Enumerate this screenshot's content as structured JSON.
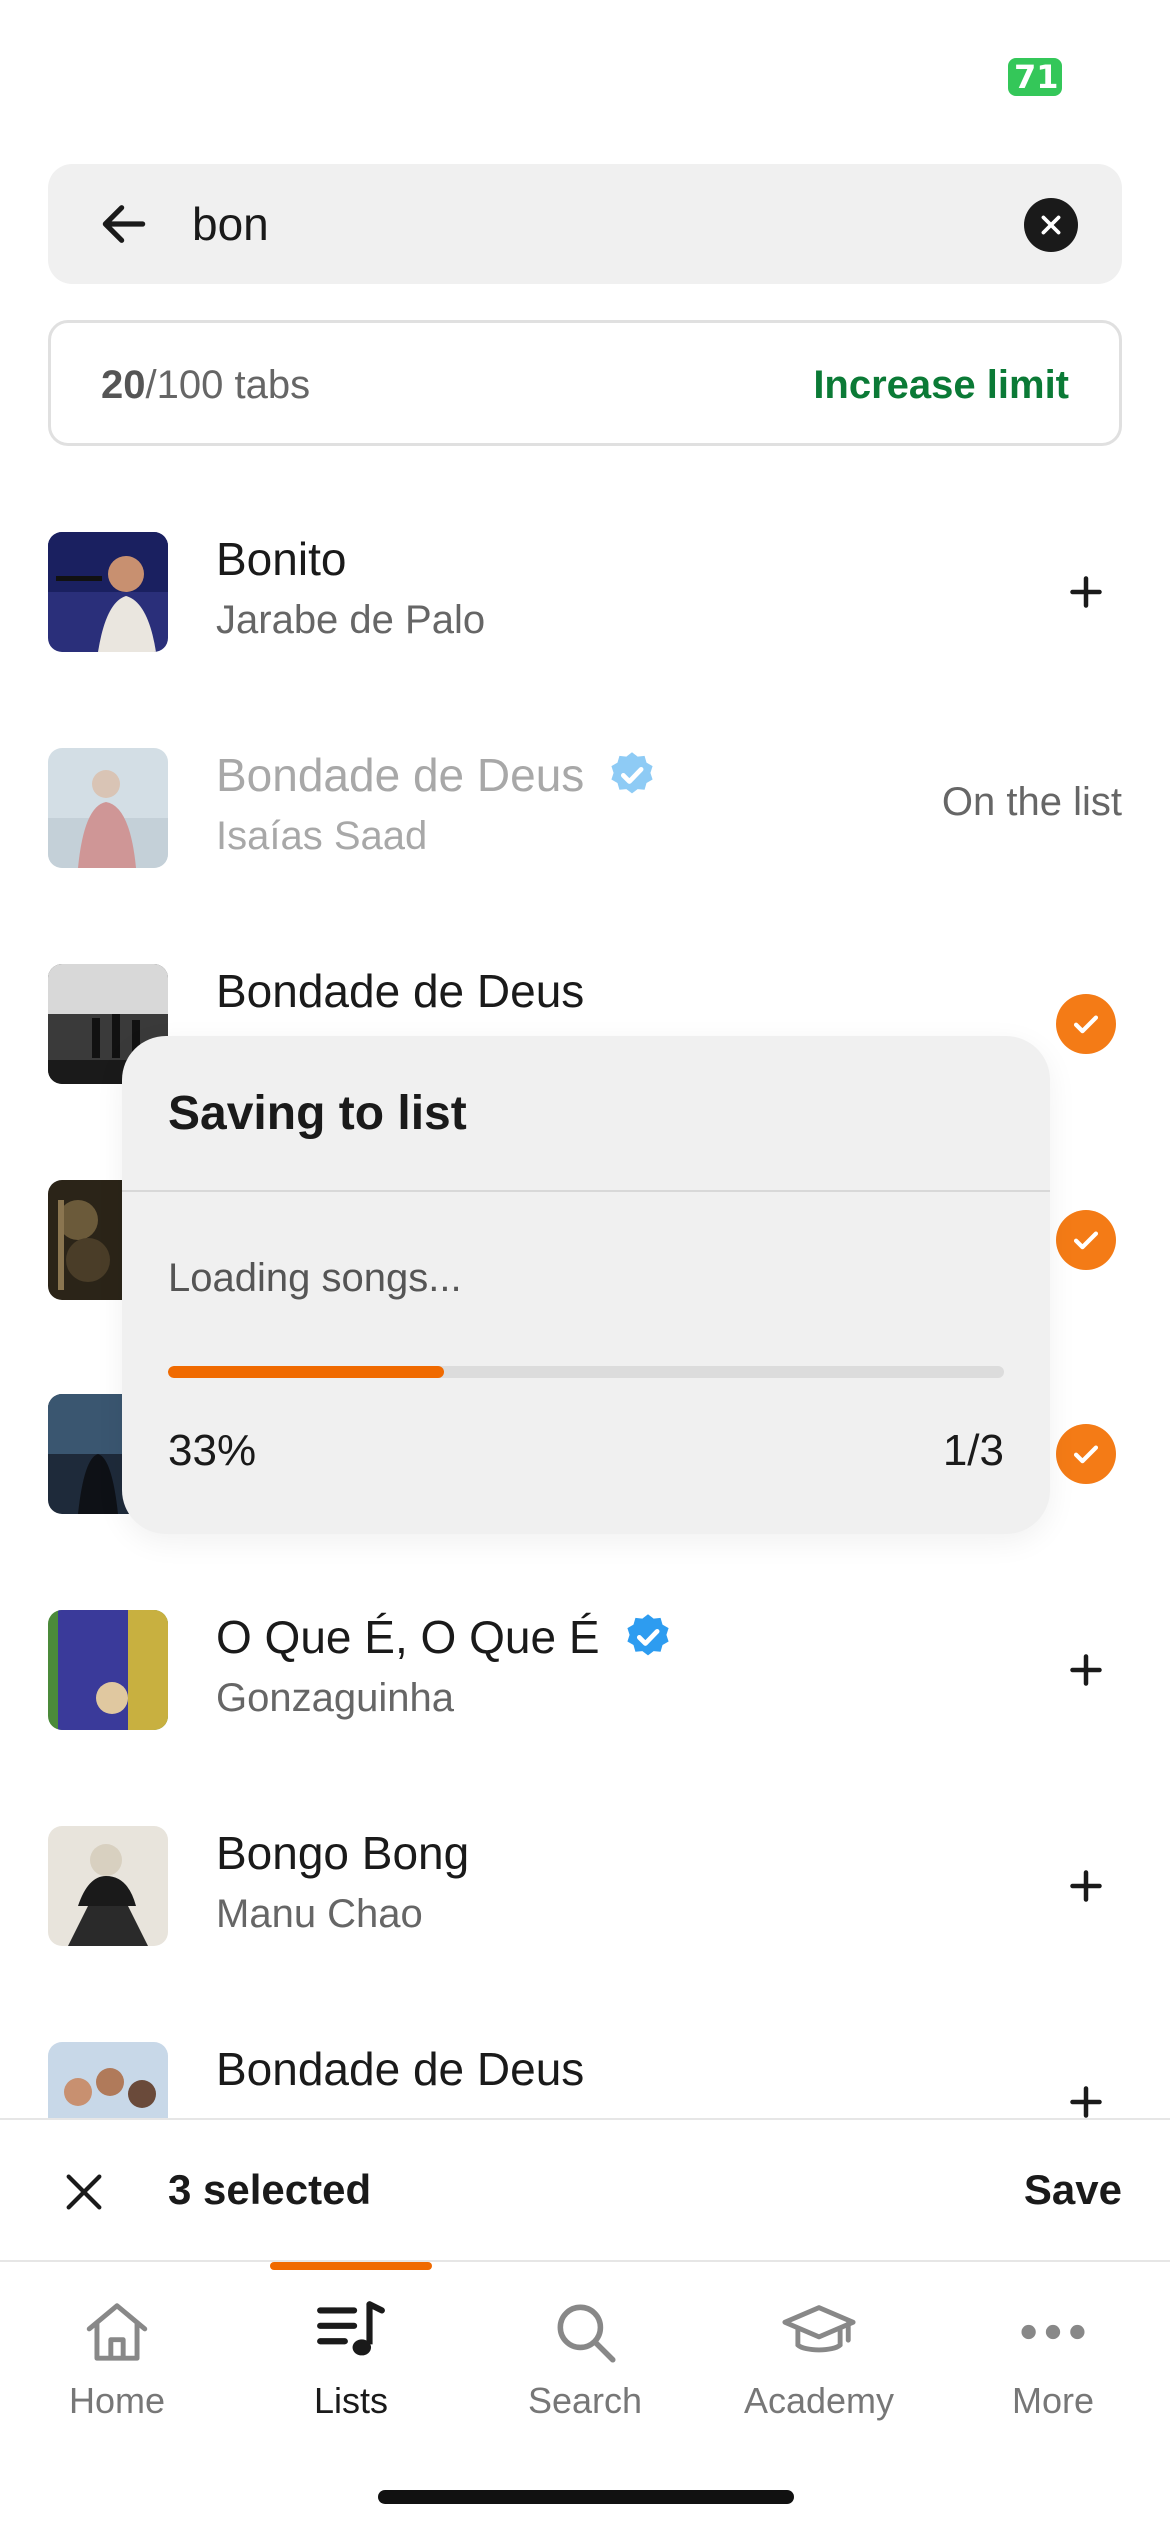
{
  "status_bar": {
    "battery": "71"
  },
  "search": {
    "value": "bon",
    "placeholder": ""
  },
  "limit": {
    "used": "20",
    "rest": "/100 tabs",
    "action": "Increase limit"
  },
  "songs": [
    {
      "title": "Bonito",
      "artist": "Jarabe de Palo",
      "verified": false,
      "state": "add"
    },
    {
      "title": "Bondade de Deus",
      "artist": "Isaías Saad",
      "verified": true,
      "state": "on-list",
      "status_label": "On the list"
    },
    {
      "title": "Bondade de Deus",
      "artist": "",
      "verified": false,
      "state": "selected"
    },
    {
      "title": "",
      "artist": "",
      "verified": false,
      "state": "selected"
    },
    {
      "title": "",
      "artist": "",
      "verified": false,
      "state": "selected"
    },
    {
      "title": "O Que É, O Que É",
      "artist": "Gonzaguinha",
      "verified": true,
      "state": "add"
    },
    {
      "title": "Bongo Bong",
      "artist": "Manu Chao",
      "verified": false,
      "state": "add"
    },
    {
      "title": "Bondade de Deus",
      "artist": "",
      "verified": false,
      "state": "add"
    }
  ],
  "modal": {
    "title": "Saving to list",
    "status": "Loading songs...",
    "progress": 0.33,
    "percent_label": "33%",
    "count_label": "1/3"
  },
  "selection": {
    "count_label": "3 selected",
    "save_label": "Save"
  },
  "tabs": [
    {
      "label": "Home",
      "icon": "home-icon"
    },
    {
      "label": "Lists",
      "icon": "lists-icon",
      "active": true
    },
    {
      "label": "Search",
      "icon": "search-icon"
    },
    {
      "label": "Academy",
      "icon": "graduation-cap-icon"
    },
    {
      "label": "More",
      "icon": "more-icon"
    }
  ],
  "colors": {
    "accent": "#f06a00",
    "link_green": "#0b7a36",
    "battery": "#34c759",
    "verified_blue": "#2d9cf0"
  }
}
